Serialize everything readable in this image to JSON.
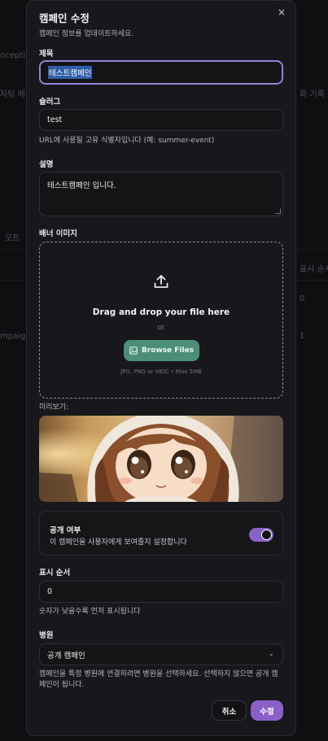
{
  "background": {
    "frag1": "ncepti",
    "frag2": "자팅 메",
    "frag3": "화 기록",
    "frag4": "모트",
    "frag5": "표시 순서",
    "frag6": "0",
    "frag7": "mpaign",
    "frag8": "1"
  },
  "modal": {
    "title": "캠페인 수정",
    "subtitle": "캠페인 정보를 업데이트하세요.",
    "close_icon": "×"
  },
  "fields": {
    "title_label": "제목",
    "title_value": "테스트캠페인",
    "slug_label": "슬러그",
    "slug_value": "test",
    "slug_hint": "URL에 사용될 고유 식별자입니다 (예: summer-event)",
    "desc_label": "설명",
    "desc_value": "테스트캠페인 입니다.",
    "banner_label": "배너 이미지",
    "preview_label": "미리보기:",
    "order_label": "표시 순서",
    "order_value": "0",
    "order_hint": "숫자가 낮을수록 먼저 표시됩니다",
    "hospital_label": "병원",
    "hospital_value": "공개 캠페인",
    "hospital_hint": "캠페인을 특정 병원에 연결하려면 병원을 선택하세요. 선택하지 않으면 공개 캠페인이 됩니다."
  },
  "dropzone": {
    "icon": "upload-icon",
    "title": "Drag and drop your file here",
    "or": "or",
    "browse_label": "Browse Files",
    "meta": "JPG, PNG or HEIC • Max 5MB"
  },
  "visibility": {
    "title": "공개 여부",
    "description": "이 캠페인을 사용자에게 보여줄지 설정합니다",
    "enabled": true
  },
  "actions": {
    "cancel": "취소",
    "submit": "수정"
  },
  "colors": {
    "accent": "#8b5fc8",
    "browse": "#4c8f78",
    "focus": "#9a7fd6"
  }
}
